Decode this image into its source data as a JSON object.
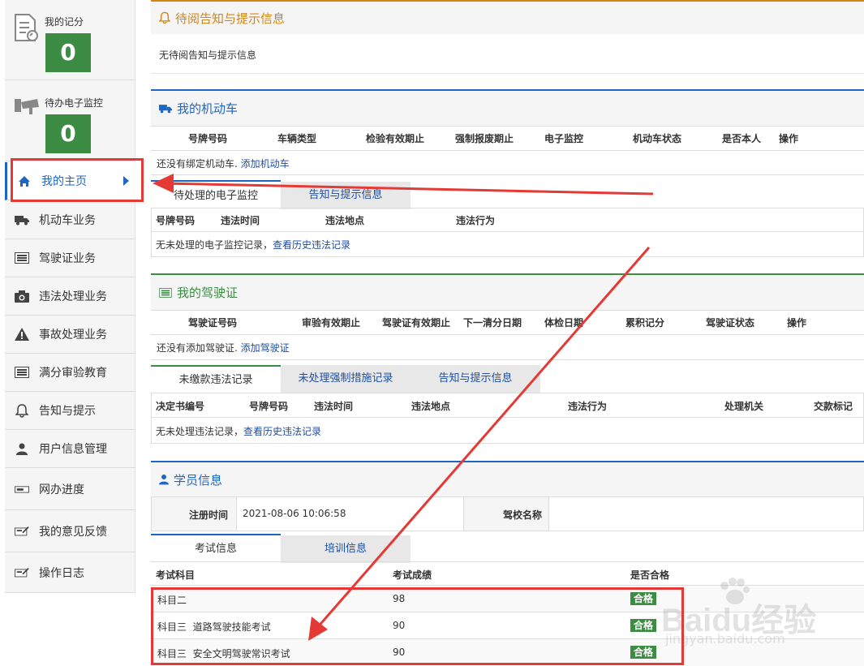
{
  "sidebar": {
    "score": {
      "label": "我的记分",
      "value": "0"
    },
    "pending_monitor": {
      "label": "待办电子监控",
      "value": "0"
    },
    "items": [
      {
        "label": "我的主页",
        "icon": "home-icon"
      },
      {
        "label": "机动车业务",
        "icon": "truck-icon"
      },
      {
        "label": "驾驶证业务",
        "icon": "card-icon"
      },
      {
        "label": "违法处理业务",
        "icon": "camera-icon"
      },
      {
        "label": "事故处理业务",
        "icon": "warning-icon"
      },
      {
        "label": "满分审验教育",
        "icon": "card-icon"
      },
      {
        "label": "告知与提示",
        "icon": "bell-icon"
      },
      {
        "label": "用户信息管理",
        "icon": "user-icon"
      },
      {
        "label": "网办进度",
        "icon": "progress-icon"
      },
      {
        "label": "我的意见反馈",
        "icon": "feedback-icon"
      },
      {
        "label": "操作日志",
        "icon": "log-icon"
      }
    ]
  },
  "notice": {
    "title": "待阅告知与提示信息",
    "empty": "无待阅告知与提示信息"
  },
  "vehicle": {
    "title": "我的机动车",
    "columns": [
      "号牌号码",
      "车辆类型",
      "检验有效期止",
      "强制报废期止",
      "电子监控",
      "机动车状态",
      "是否本人",
      "操作"
    ],
    "empty_text": "还没有绑定机动车.",
    "add_link": "添加机动车",
    "tabs": [
      "待处理的电子监控",
      "告知与提示信息"
    ],
    "monitor_columns": [
      "号牌号码",
      "违法时间",
      "违法地点",
      "违法行为"
    ],
    "monitor_empty": "无未处理的电子监控记录，",
    "monitor_history": "查看历史违法记录"
  },
  "license": {
    "title": "我的驾驶证",
    "columns": [
      "驾驶证号码",
      "审验有效期止",
      "驾驶证有效期止",
      "下一清分日期",
      "体检日期",
      "累积记分",
      "驾驶证状态",
      "操作"
    ],
    "empty_text": "还没有添加驾驶证.",
    "add_link": "添加驾驶证",
    "tabs": [
      "未缴款违法记录",
      "未处理强制措施记录",
      "告知与提示信息"
    ],
    "violation_columns": [
      "决定书编号",
      "号牌号码",
      "违法时间",
      "违法地点",
      "违法行为",
      "处理机关",
      "交款标记"
    ],
    "violation_empty": "无未处理违法记录，",
    "violation_history": "查看历史违法记录"
  },
  "student": {
    "title": "学员信息",
    "reg_label": "注册时间",
    "reg_value": "2021-08-06 10:06:58",
    "school_label": "驾校名称",
    "school_value": "",
    "tabs": [
      "考试信息",
      "培训信息"
    ],
    "exam_columns": [
      "考试科目",
      "考试成绩",
      "是否合格"
    ],
    "exams": [
      {
        "subject": "科目二",
        "score": "98",
        "result": "合格"
      },
      {
        "subject": "科目三  道路驾驶技能考试",
        "score": "90",
        "result": "合格"
      },
      {
        "subject": "科目三  安全文明驾驶常识考试",
        "score": "90",
        "result": "合格"
      }
    ]
  },
  "watermark": {
    "brand": "Baidu经验",
    "url": "jingyan.baidu.com"
  },
  "colors": {
    "accent_blue": "#1f66c2",
    "accent_green": "#3c8c44",
    "accent_orange": "#d58512",
    "highlight_red": "#e53935"
  }
}
